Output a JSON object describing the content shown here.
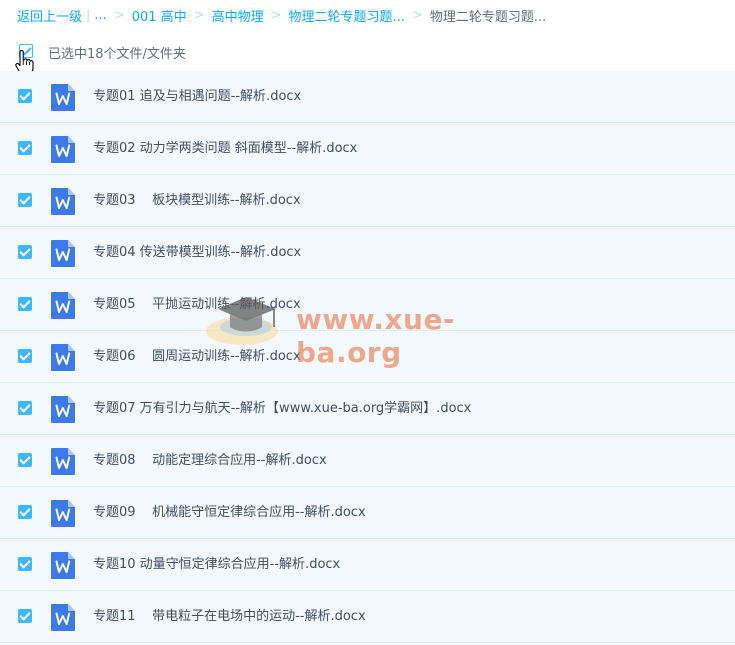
{
  "breadcrumb": {
    "back": "返回上一级",
    "ellipsis": "...",
    "items": [
      "001 高中",
      "高中物理",
      "物理二轮专题习题..."
    ],
    "current": "物理二轮专题习题..."
  },
  "selection": {
    "text": "已选中18个文件/文件夹",
    "all_checked": true
  },
  "files": [
    {
      "name": "专题01 追及与相遇问题--解析.docx",
      "checked": true,
      "icon": "word-doc-icon"
    },
    {
      "name": "专题02 动力学两类问题 斜面模型--解析.docx",
      "checked": true,
      "icon": "word-doc-icon"
    },
    {
      "name": "专题03    板块模型训练--解析.docx",
      "checked": true,
      "icon": "word-doc-icon"
    },
    {
      "name": "专题04 传送带模型训练--解析.docx",
      "checked": true,
      "icon": "word-doc-icon"
    },
    {
      "name": "专题05    平抛运动训练--解析.docx",
      "checked": true,
      "icon": "word-doc-icon"
    },
    {
      "name": "专题06    圆周运动训练--解析.docx",
      "checked": true,
      "icon": "word-doc-icon"
    },
    {
      "name": "专题07 万有引力与航天--解析【www.xue-ba.org学霸网】.docx",
      "checked": true,
      "icon": "word-doc-icon"
    },
    {
      "name": "专题08    动能定理综合应用--解析.docx",
      "checked": true,
      "icon": "word-doc-icon"
    },
    {
      "name": "专题09    机械能守恒定律综合应用--解析.docx",
      "checked": true,
      "icon": "word-doc-icon"
    },
    {
      "name": "专题10 动量守恒定律综合应用--解析.docx",
      "checked": true,
      "icon": "word-doc-icon"
    },
    {
      "name": "专题11    带电粒子在电场中的运动--解析.docx",
      "checked": true,
      "icon": "word-doc-icon"
    }
  ],
  "watermark": {
    "text": "www.xue-ba.org"
  },
  "colors": {
    "accent": "#09aaff",
    "row_bg": "#f3f9fe",
    "checkbox": "#3db8ff",
    "word_icon": "#3b7ae8"
  }
}
